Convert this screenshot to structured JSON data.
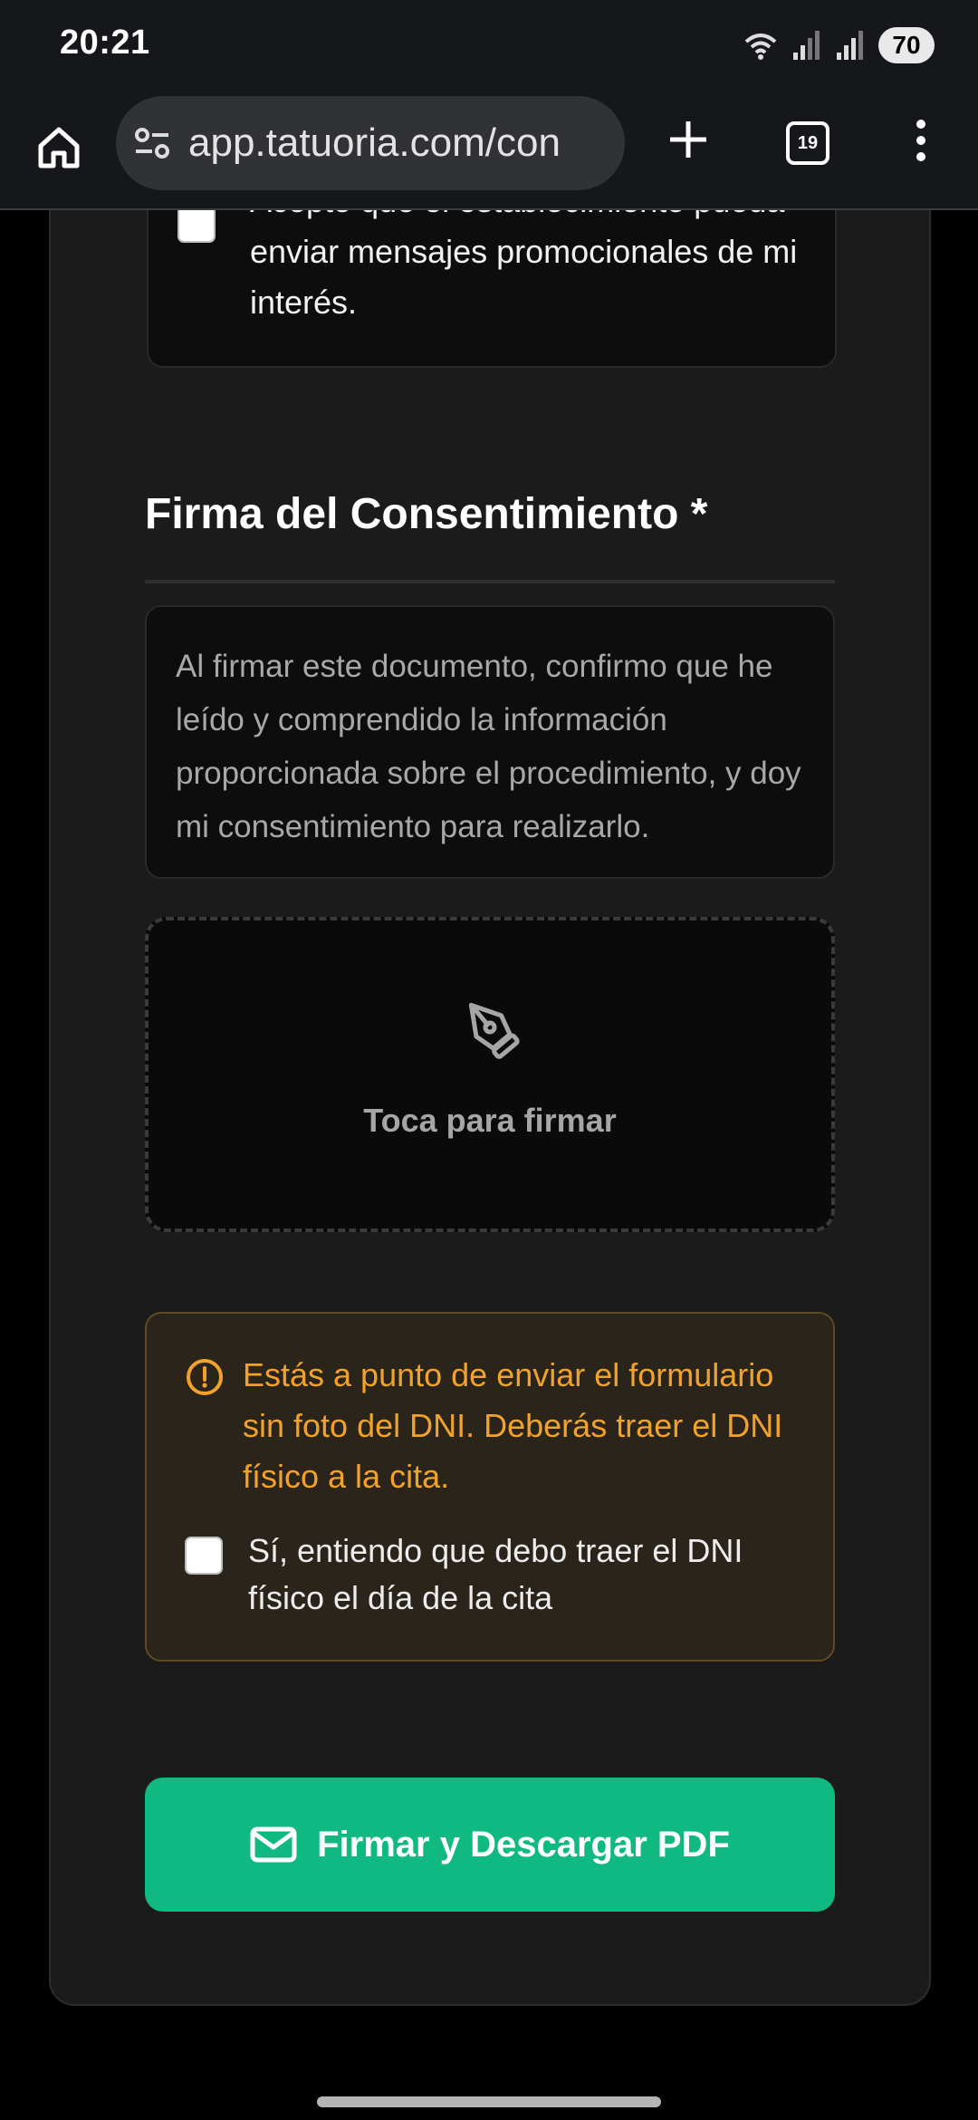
{
  "status_bar": {
    "time": "20:21",
    "battery": "70",
    "icons": [
      "wifi-icon",
      "signal-icon",
      "signal-icon",
      "battery-icon"
    ]
  },
  "browser": {
    "url": "app.tatuoria.com/con",
    "tabs_count": "19",
    "icons": [
      "home-icon",
      "site-settings-icon",
      "new-tab-icon",
      "tabs-icon",
      "menu-icon"
    ]
  },
  "form": {
    "promo_consent": {
      "label": "Acepto que el establecimiento pueda enviar mensajes promocionales de mi interés.",
      "checked": false
    },
    "signature_section": {
      "title": "Firma del Consentimiento *",
      "consent_text": "Al firmar este documento, confirmo que he leído y comprendido la información proporcionada sobre el procedimiento, y doy mi consentimiento para realizarlo.",
      "tap_to_sign": "Toca para firmar",
      "icon": "pen-icon"
    },
    "dni_warning": {
      "message": "Estás a punto de enviar el formulario sin foto del DNI. Deberás traer el DNI físico a la cita.",
      "checkbox_label": "Sí, entiendo que debo traer el DNI físico el día de la cita",
      "checked": false,
      "icon": "alert-circle-icon",
      "color": "#f0a22a"
    },
    "submit": {
      "label": "Firmar y Descargar PDF",
      "icon": "mail-icon",
      "color": "#10b981"
    }
  }
}
